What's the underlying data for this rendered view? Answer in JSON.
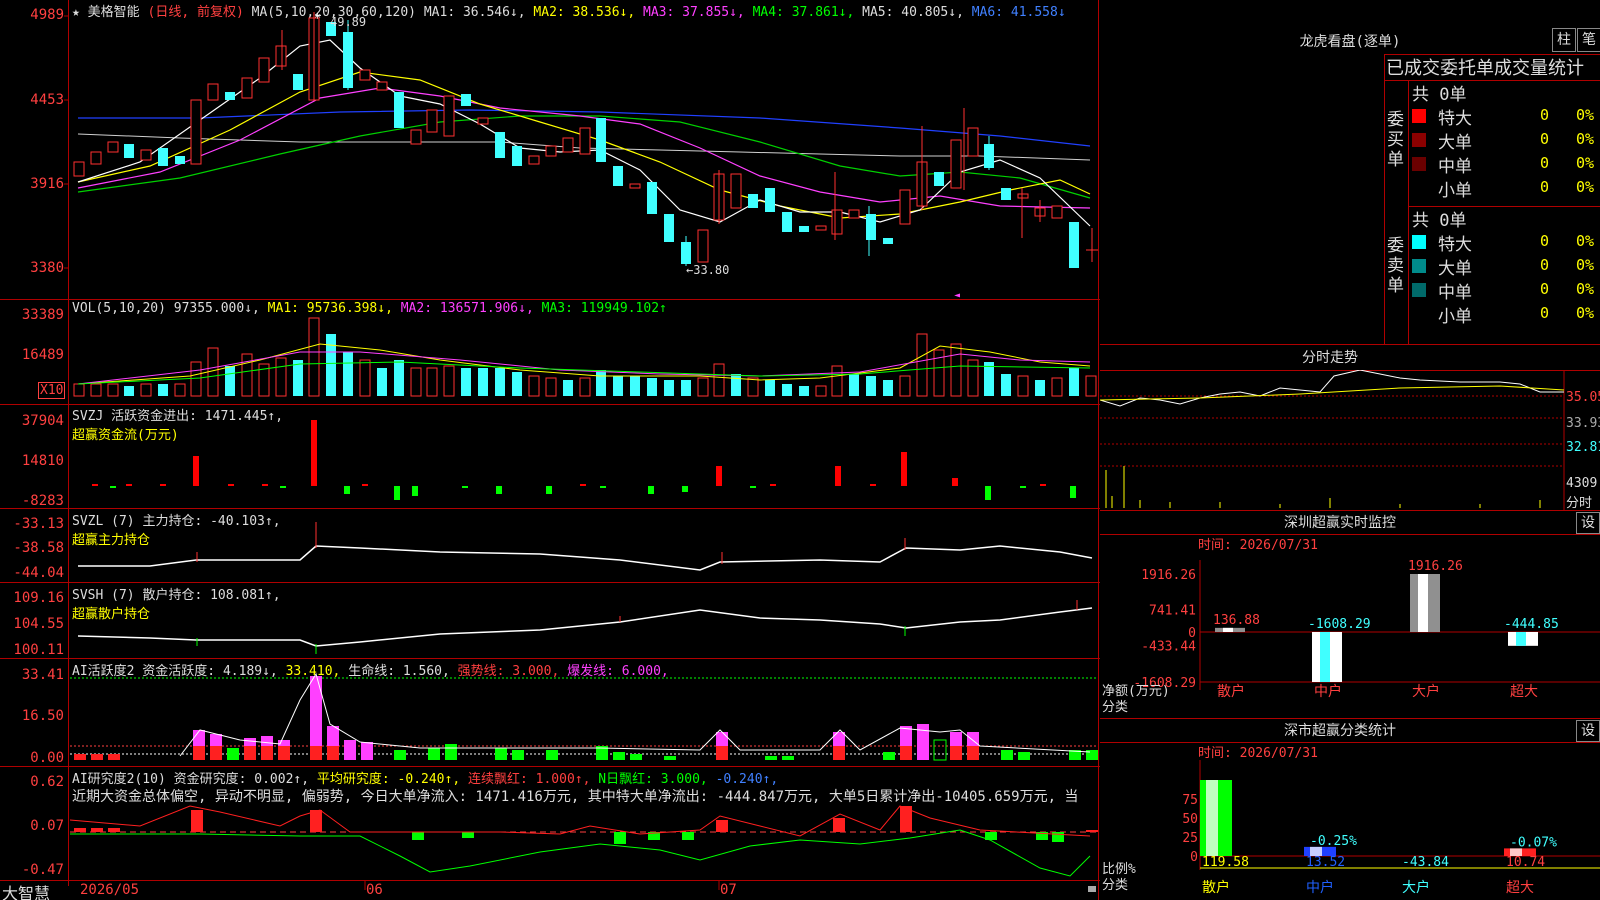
{
  "header": {
    "stock_name": "美格智能",
    "period": "(日线, 前复权)",
    "ma_label": "MA(5,10,20,30,60,120)",
    "ma1": "MA1: 36.546↓,",
    "ma2": "MA2: 38.536↓,",
    "ma3": "MA3: 37.855↓,",
    "ma4": "MA4: 37.861↓,",
    "ma5": "MA5: 40.805↓,",
    "ma6": "MA6: 41.558↓"
  },
  "main_chart": {
    "y_ticks": [
      "4989",
      "4453",
      "3916",
      "3380"
    ],
    "high_mark": "49.89",
    "low_mark": "33.80"
  },
  "vol": {
    "title": "VOL(5,10,20)",
    "value": "97355.000↓,",
    "ma1": "MA1: 95736.398↓,",
    "ma2": "MA2: 136571.906↓,",
    "ma3": "MA3: 119949.102↑",
    "y_ticks": [
      "33389",
      "16489"
    ],
    "unit": "X10"
  },
  "svzj": {
    "title": "SVZJ  活跃资金进出: 1471.445↑,",
    "subtitle": "超赢资金流(万元)",
    "y_ticks": [
      "37904",
      "14810",
      "-8283"
    ]
  },
  "svzl": {
    "title": "SVZL (7) 主力持仓: -40.103↑,",
    "subtitle": "超赢主力持仓",
    "y_ticks": [
      "-33.13",
      "-38.58",
      "-44.04"
    ]
  },
  "svsh": {
    "title": "SVSH (7) 散户持仓: 108.081↑,",
    "subtitle": "超赢散户持仓",
    "y_ticks": [
      "109.16",
      "104.55",
      "100.11"
    ]
  },
  "ai_active": {
    "title": "AI活跃度2 资金活跃度: 4.189↓,",
    "v2": "33.410,",
    "v3": "生命线: 1.560,",
    "v4": "强势线: 3.000,",
    "v5": "爆发线: 6.000,",
    "y_ticks": [
      "33.41",
      "16.50",
      "0.00"
    ]
  },
  "ai_research": {
    "title": "AI研究度2(10) 资金研究度: 0.002↑,",
    "v2": "平均研究度: -0.240↑,",
    "v3": "连续飘红: 1.000↑,",
    "v4": "N日飘红: 3.000,",
    "v5": "-0.240↑,",
    "note": "近期大资金总体偏空, 异动不明显, 偏弱势, 今日大单净流入: 1471.416万元, 其中特大单净流出: -444.847万元, 大单5日累计净出-10405.659万元, 当",
    "y_ticks": [
      "0.62",
      "0.07",
      "-0.47"
    ]
  },
  "bottom_axis": {
    "brand": "大智慧",
    "dates": [
      "2026/05",
      "06",
      "07"
    ]
  },
  "dragon": {
    "title": "龙虎看盘(逐单)",
    "btn1": "柱",
    "btn2": "笔",
    "heading": "已成交委托单成交量统计",
    "buy_label": "委买单",
    "sell_label": "委卖单",
    "buy_total": "共 0单",
    "sell_total": "共 0单",
    "buy_rows": [
      {
        "name": "特大",
        "count": "0",
        "pct": "0%",
        "color": "#ff0000"
      },
      {
        "name": "大单",
        "count": "0",
        "pct": "0%",
        "color": "#8b0000"
      },
      {
        "name": "中单",
        "count": "0",
        "pct": "0%",
        "color": "#6a0000"
      },
      {
        "name": "小单",
        "count": "0",
        "pct": "0%",
        "color": "#000000"
      }
    ],
    "sell_rows": [
      {
        "name": "特大",
        "count": "0",
        "pct": "0%",
        "color": "#00ffff"
      },
      {
        "name": "大单",
        "count": "0",
        "pct": "0%",
        "color": "#008b8b"
      },
      {
        "name": "中单",
        "count": "0",
        "pct": "0%",
        "color": "#006a6a"
      },
      {
        "name": "小单",
        "count": "0",
        "pct": "0%",
        "color": "#000000"
      }
    ]
  },
  "intraday": {
    "title": "分时走势",
    "price_ticks": [
      "35.05",
      "33.93",
      "32.81"
    ],
    "vol_tick": "4309",
    "vol_unit": "分时"
  },
  "sz_monitor": {
    "title": "深圳超赢实时监控",
    "btn": "设",
    "time": "时间: 2026/07/31",
    "y_ticks": [
      "1916.26",
      "741.41",
      "0",
      "-433.44",
      "-1608.29"
    ],
    "unit_label": "净额(万元)",
    "cat_label": "分类",
    "categories": [
      "散户",
      "中户",
      "大户",
      "超大"
    ],
    "values": [
      136.88,
      -1608.29,
      1916.26,
      -444.85
    ],
    "value_labels": [
      "136.88",
      "-1608.29",
      "1916.26",
      "-444.85"
    ]
  },
  "sz_stats": {
    "title": "深市超赢分类统计",
    "btn": "设",
    "time": "时间: 2026/07/31",
    "y_ticks": [
      "75",
      "50",
      "25",
      "0"
    ],
    "unit_label": "比例%",
    "cat_label": "分类",
    "categories": [
      "散户",
      "中户",
      "大户",
      "超大"
    ],
    "pct_labels": [
      "",
      "-0.25%",
      "",
      "-0.07%"
    ],
    "values": [
      "119.58",
      "13.52",
      "-43.84",
      "10.74"
    ]
  }
}
